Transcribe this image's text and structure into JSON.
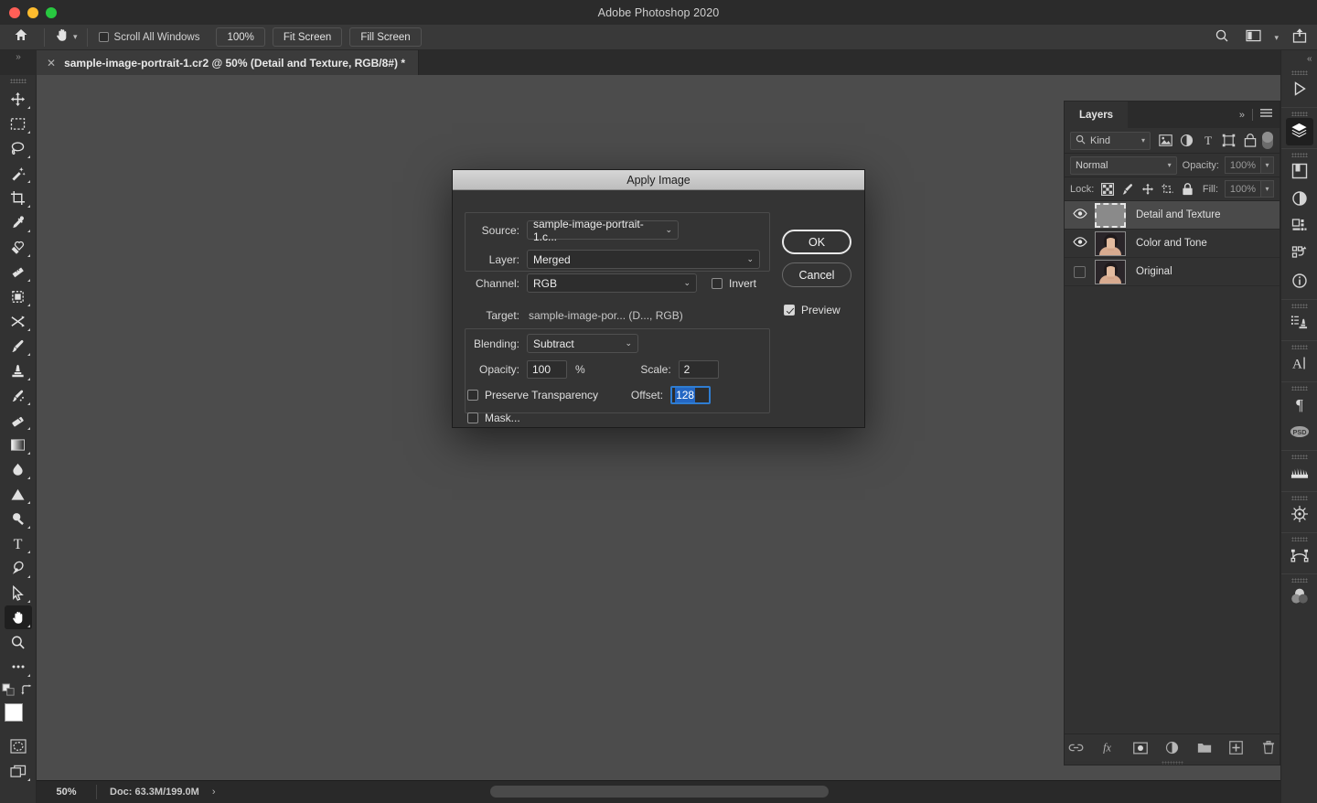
{
  "window": {
    "app_title": "Adobe Photoshop 2020",
    "traffic_lights": [
      "close-red",
      "minimize-yellow",
      "maximize-green"
    ]
  },
  "options_bar": {
    "home_icon": "home-icon",
    "active_tool_icon": "hand-tool-icon",
    "tool_chevron": "chevron-down-icon",
    "scroll_all_windows": {
      "label": "Scroll All Windows",
      "checked": false
    },
    "buttons": [
      {
        "label": "100%",
        "name": "zoom-100-button"
      },
      {
        "label": "Fit Screen",
        "name": "fit-screen-button"
      },
      {
        "label": "Fill Screen",
        "name": "fill-screen-button"
      }
    ],
    "right_icons": [
      "search-icon",
      "workspace-icon",
      "chevron-down-icon",
      "share-icon"
    ]
  },
  "document_tab": {
    "expand_icon": "double-chevron-right-icon",
    "close_icon": "close-icon",
    "title": "sample-image-portrait-1.cr2 @ 50% (Detail and Texture, RGB/8#) *"
  },
  "toolbox": {
    "tools": [
      {
        "name": "move-tool",
        "icon": "move-icon",
        "has_flyout": true,
        "active": false
      },
      {
        "name": "rectangular-marquee-tool",
        "icon": "marquee-icon",
        "has_flyout": true,
        "active": false
      },
      {
        "name": "lasso-tool",
        "icon": "lasso-icon",
        "has_flyout": true,
        "active": false
      },
      {
        "name": "quick-selection-tool",
        "icon": "magic-wand-icon",
        "has_flyout": true,
        "active": false
      },
      {
        "name": "crop-tool",
        "icon": "crop-icon",
        "has_flyout": true,
        "active": false
      },
      {
        "name": "eyedropper-tool",
        "icon": "eyedropper-icon",
        "has_flyout": true,
        "active": false
      },
      {
        "name": "spot-healing-brush-tool",
        "icon": "healing-brush-icon",
        "has_flyout": true,
        "active": false
      },
      {
        "name": "patch-tool",
        "icon": "patch-icon",
        "has_flyout": true,
        "active": false
      },
      {
        "name": "frame-tool",
        "icon": "frame-icon",
        "has_flyout": true,
        "active": false
      },
      {
        "name": "shuffle-tool",
        "icon": "shuffle-icon",
        "has_flyout": true,
        "active": false
      },
      {
        "name": "brush-tool",
        "icon": "brush-icon",
        "has_flyout": true,
        "active": false
      },
      {
        "name": "clone-stamp-tool",
        "icon": "stamp-icon",
        "has_flyout": true,
        "active": false
      },
      {
        "name": "history-brush-tool",
        "icon": "history-brush-icon",
        "has_flyout": true,
        "active": false
      },
      {
        "name": "eraser-tool",
        "icon": "eraser-icon",
        "has_flyout": true,
        "active": false
      },
      {
        "name": "gradient-tool",
        "icon": "gradient-icon",
        "has_flyout": true,
        "active": false
      },
      {
        "name": "blur-tool",
        "icon": "blur-drop-icon",
        "has_flyout": true,
        "active": false
      },
      {
        "name": "dodge-tool",
        "icon": "triangle-icon",
        "has_flyout": true,
        "active": false
      },
      {
        "name": "burn-tool",
        "icon": "dodge-icon",
        "has_flyout": true,
        "active": false
      },
      {
        "name": "type-tool",
        "icon": "type-t-icon",
        "has_flyout": true,
        "active": false
      },
      {
        "name": "pen-tool",
        "icon": "pen-icon",
        "has_flyout": true,
        "active": false
      },
      {
        "name": "path-selection-tool",
        "icon": "arrow-cursor-icon",
        "has_flyout": true,
        "active": false
      },
      {
        "name": "hand-tool",
        "icon": "hand-icon",
        "has_flyout": true,
        "active": true
      },
      {
        "name": "zoom-tool",
        "icon": "magnifier-icon",
        "has_flyout": false,
        "active": false
      },
      {
        "name": "edit-toolbar",
        "icon": "ellipsis-icon",
        "has_flyout": true,
        "active": false
      }
    ],
    "swap_colors_icon": "swap-colors-icon",
    "default_colors_icon": "default-colors-icon",
    "foreground_color": "#ffffff",
    "background_color": "#4e7896",
    "quick_mask_icon": "quick-mask-icon",
    "screen_mode_icon": "screen-mode-icon"
  },
  "status_bar": {
    "zoom": "50%",
    "doc_info": "Doc: 63.3M/199.0M",
    "expand_arrow": "›"
  },
  "right_rail": {
    "collapse_icon": "double-chevron-left-icon",
    "icons": [
      {
        "name": "play-icon",
        "active": false
      },
      {
        "name": "layers-icon",
        "active": true
      },
      {
        "name": "libraries-icon",
        "active": false
      },
      {
        "name": "adjustments-icon",
        "active": false
      },
      {
        "name": "properties-icon",
        "active": false
      },
      {
        "name": "actions-icon",
        "active": false
      },
      {
        "name": "info-icon",
        "active": false
      },
      {
        "name": "clone-source-icon",
        "active": false
      },
      {
        "name": "character-icon",
        "active": false
      },
      {
        "name": "paragraph-icon",
        "active": false
      },
      {
        "name": "psd-icon",
        "active": false
      },
      {
        "name": "brush-settings-icon",
        "active": false
      },
      {
        "name": "navigator-icon",
        "active": false
      },
      {
        "name": "paths-icon",
        "active": false
      },
      {
        "name": "channels-icon",
        "active": false
      }
    ]
  },
  "layers_panel": {
    "tab_label": "Layers",
    "collapse_icon": "double-chevron-right-icon",
    "menu_icon": "hamburger-menu-icon",
    "filter": {
      "search_icon": "search-icon",
      "kind_label": "Kind",
      "chevron": "chevron-down-icon",
      "filter_icons": [
        "pixel-layer-icon",
        "adjustment-layer-icon",
        "type-layer-icon",
        "shape-layer-icon",
        "smart-object-icon"
      ],
      "toggle_icon": "filter-toggle-icon"
    },
    "blend": {
      "mode": "Normal",
      "chevron": "chevron-down-icon",
      "opacity_label": "Opacity:",
      "opacity_value": "100%",
      "spinner_icon": "chevron-down-icon"
    },
    "lock": {
      "label": "Lock:",
      "icons": [
        "lock-transparency-icon",
        "lock-image-icon",
        "lock-position-icon",
        "lock-artboard-icon",
        "lock-all-icon"
      ],
      "fill_label": "Fill:",
      "fill_value": "100%",
      "spinner_icon": "chevron-down-icon"
    },
    "layers": [
      {
        "name": "Detail and Texture",
        "visible": true,
        "selected": true,
        "thumb": "empty-gray"
      },
      {
        "name": "Color and Tone",
        "visible": true,
        "selected": false,
        "thumb": "portrait"
      },
      {
        "name": "Original",
        "visible": false,
        "selected": false,
        "thumb": "portrait"
      }
    ],
    "footer_icons": [
      {
        "name": "link-layers-icon"
      },
      {
        "name": "layer-style-fx-icon"
      },
      {
        "name": "add-layer-mask-icon"
      },
      {
        "name": "new-adjustment-layer-icon"
      },
      {
        "name": "new-group-icon"
      },
      {
        "name": "new-layer-icon"
      },
      {
        "name": "delete-layer-icon"
      }
    ]
  },
  "dialog": {
    "title": "Apply Image",
    "source_label": "Source:",
    "source_value": "sample-image-portrait-1.c...",
    "layer_label": "Layer:",
    "layer_value": "Merged",
    "channel_label": "Channel:",
    "channel_value": "RGB",
    "invert_label": "Invert",
    "invert_checked": false,
    "target_label": "Target:",
    "target_value": "sample-image-por... (D..., RGB)",
    "blending_label": "Blending:",
    "blending_value": "Subtract",
    "opacity_label": "Opacity:",
    "opacity_value": "100",
    "opacity_unit": "%",
    "scale_label": "Scale:",
    "scale_value": "2",
    "offset_label": "Offset:",
    "offset_value": "128",
    "offset_focused": true,
    "preserve_transparency_label": "Preserve Transparency",
    "preserve_transparency_checked": false,
    "mask_label": "Mask...",
    "mask_checked": false,
    "ok_label": "OK",
    "cancel_label": "Cancel",
    "preview_label": "Preview",
    "preview_checked": true,
    "chevron_icon": "chevron-down-icon"
  },
  "colors": {
    "accent_blue": "#2467c4",
    "focus_blue": "#2f7dd1",
    "panel_bg": "#323232",
    "canvas_bg": "#4c4c4c",
    "dialog_bg": "#343434"
  }
}
